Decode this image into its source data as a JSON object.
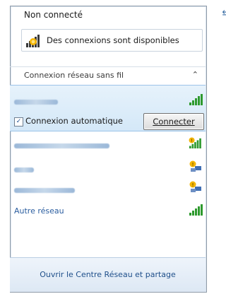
{
  "header": {
    "status": "Non connecté",
    "refresh_icon": "refresh-icon",
    "availability_text": "Des connexions sont disponibles",
    "availability_icon": "network-available-icon"
  },
  "section": {
    "label": "Connexion réseau sans fil",
    "collapse_icon": "chevron-up-icon"
  },
  "networks": [
    {
      "name": "",
      "signal": 5,
      "secured": false,
      "selected": true
    },
    {
      "name": "",
      "signal": 5,
      "secured": true,
      "selected": false
    },
    {
      "name": "",
      "signal": 3,
      "secured": true,
      "selected": false
    },
    {
      "name": "",
      "signal": 3,
      "secured": true,
      "selected": false
    }
  ],
  "selected_network": {
    "auto_connect_label": "Connexion automatique",
    "auto_connect_checked": true,
    "connect_button_label": "Connecter"
  },
  "other_network": {
    "label": "Autre réseau",
    "signal": 5
  },
  "footer": {
    "link_text": "Ouvrir le Centre Réseau et partage"
  },
  "colors": {
    "accent_link": "#2a5d9f",
    "signal_green": "#2e9a2e",
    "selection_bg": "#d4e8f8"
  }
}
